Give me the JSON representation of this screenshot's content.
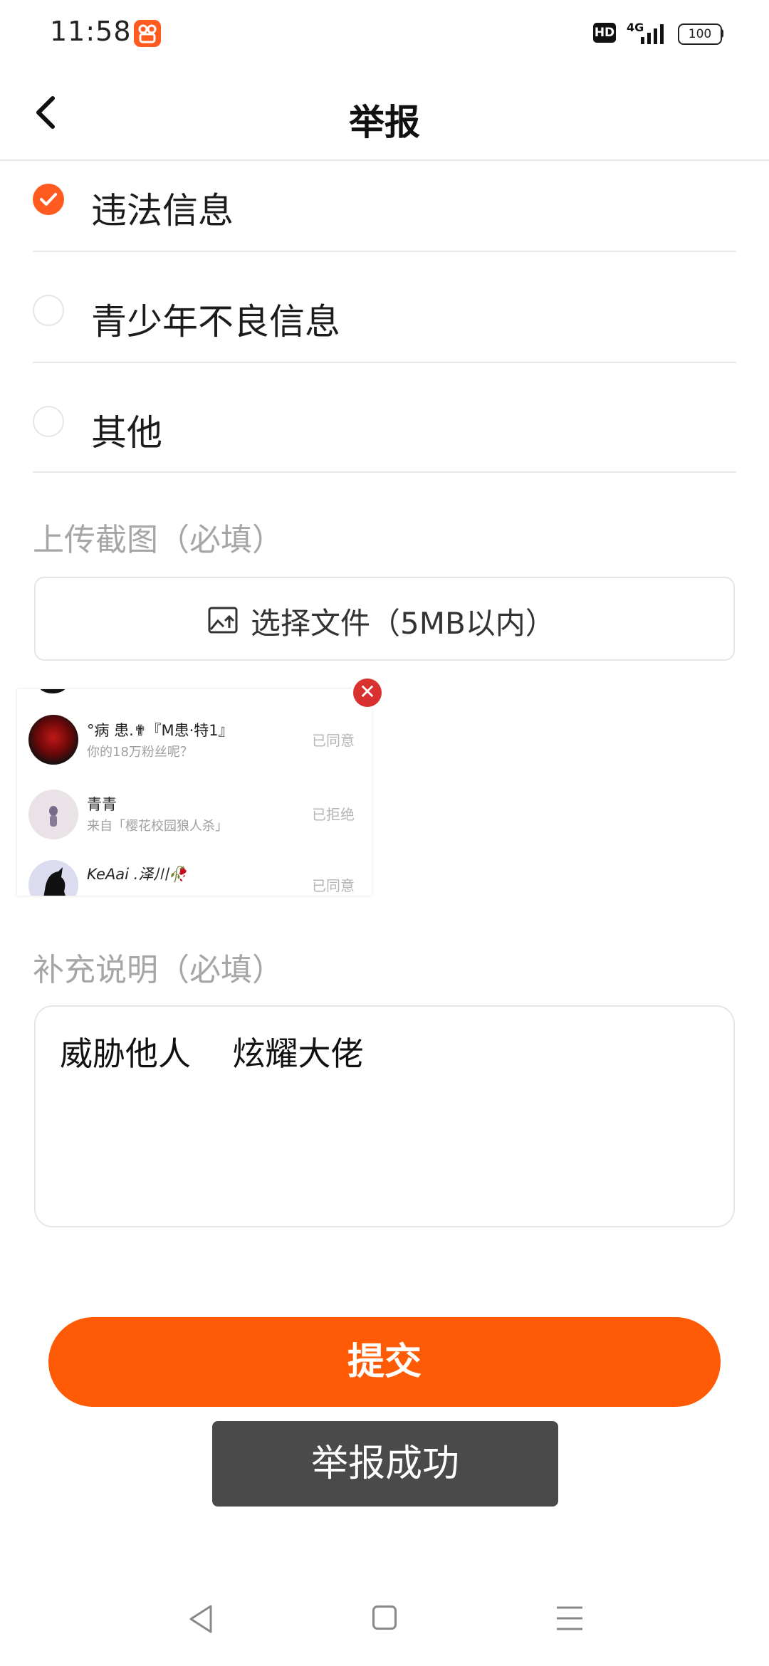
{
  "status_bar": {
    "time": "11:58",
    "hd_badge": "HD",
    "network": "4G",
    "battery": "100"
  },
  "header": {
    "title": "举报",
    "back_icon": "chevron-left-icon"
  },
  "options": [
    {
      "label": "违法信息",
      "selected": true
    },
    {
      "label": "青少年不良信息",
      "selected": false
    },
    {
      "label": "其他",
      "selected": false
    }
  ],
  "upload": {
    "section_label": "上传截图（必填）",
    "button_label": "选择文件（5MB以内）",
    "icon": "image-upload-icon"
  },
  "screenshot_preview": {
    "rows": [
      {
        "name": "°病 患.✟『M患·特1』",
        "subtitle": "你的18万粉丝呢？",
        "status": "已同意"
      },
      {
        "name": "青青",
        "subtitle": "来自「樱花校园狼人杀」",
        "status": "已拒绝"
      },
      {
        "name": "KeAai .泽川🥀",
        "subtitle": "",
        "status": "已同意"
      }
    ],
    "remove_icon": "close-circle-icon"
  },
  "description": {
    "section_label": "补充说明（必填）",
    "value": "威胁他人    炫耀大佬"
  },
  "submit": {
    "label": "提交"
  },
  "toast": {
    "text": "举报成功"
  },
  "colors": {
    "accent": "#ff5a05",
    "toast_bg": "#4a4a4a",
    "remove_red": "#d93030"
  }
}
